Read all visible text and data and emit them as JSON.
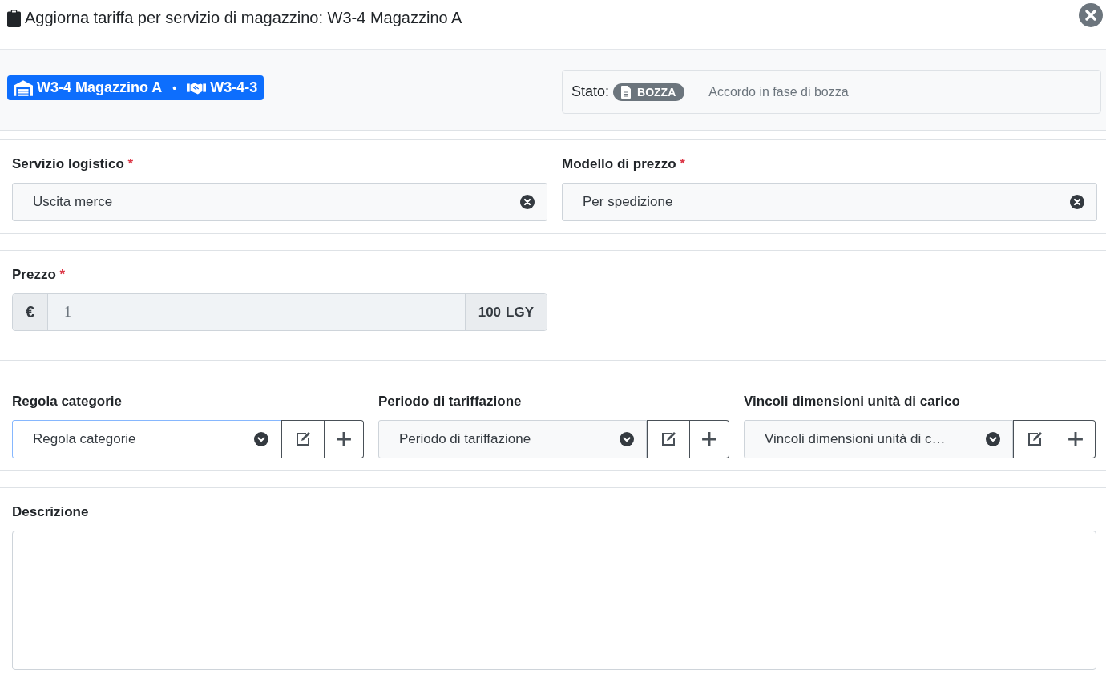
{
  "window": {
    "title": "Aggiorna tariffa per servizio di magazzino: W3-4 Magazzino A"
  },
  "header_badge": {
    "warehouse": "W3-4 Magazzino A",
    "separator": "•",
    "agreement": "W3-4-3"
  },
  "status": {
    "label": "Stato:",
    "badge": "BOZZA",
    "description": "Accordo in fase di bozza"
  },
  "row_1": [
    {
      "label": "Servizio logistico",
      "required_mark": "*",
      "value": "Uscita merce"
    },
    {
      "label": "Modello di prezzo",
      "required_mark": "*",
      "value": "Per spedizione"
    }
  ],
  "price": {
    "label": "Prezzo",
    "required_mark": "*",
    "prefix": "€",
    "value": "1",
    "suffix_amount": "100",
    "suffix_unit": "LGY"
  },
  "selects": [
    {
      "label": "Regola categorie",
      "placeholder": "Regola categorie",
      "focused": true
    },
    {
      "label": "Periodo di tariffazione",
      "placeholder": "Periodo di tariffazione",
      "focused": false
    },
    {
      "label": "Vincoli dimensioni unità di carico",
      "placeholder": "Vincoli dimensioni unità di c…",
      "focused": false
    }
  ],
  "description": {
    "label": "Descrizione"
  }
}
